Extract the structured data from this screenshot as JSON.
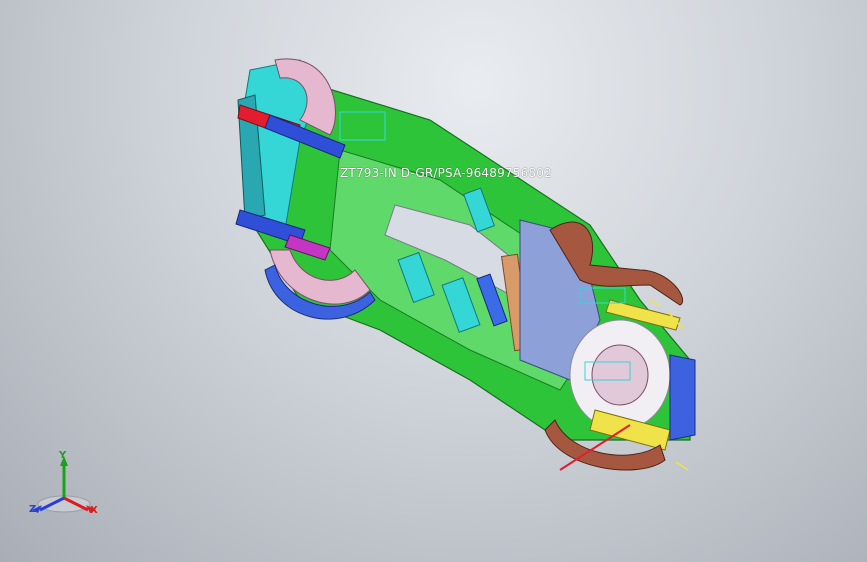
{
  "viewer": {
    "background_top": "#e9ecf0",
    "background_bottom": "#a9aeb6"
  },
  "model": {
    "part_label": "ZT793-IN D-GR/PSA-96489756802",
    "colors": {
      "frame_green": "#3bd43b",
      "panel_cyan": "#35d6d6",
      "bracket_blue": "#2f4fd8",
      "floor_gray": "#cfd3dc",
      "plate_yellow": "#f0e34a",
      "wheelhouse_pink": "#e6b8cf",
      "brake_rust": "#a6573f",
      "crossmember_orange": "#d99a6a",
      "bar_red": "#e21e2e",
      "tab_magenta": "#c435c4"
    }
  },
  "triad": {
    "x_label": "X",
    "y_label": "Y",
    "z_label": "Z",
    "x_color": "#d81e1e",
    "y_color": "#1aa31a",
    "z_color": "#2a3fd6"
  }
}
